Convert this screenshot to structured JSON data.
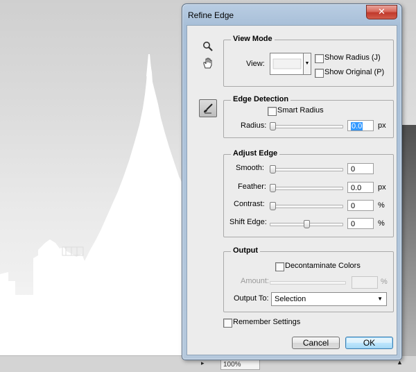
{
  "dialog": {
    "title": "Refine Edge",
    "close_glyph": "✕"
  },
  "view_mode": {
    "title": "View Mode",
    "view_label": "View:",
    "show_radius": "Show Radius (J)",
    "show_original": "Show Original (P)"
  },
  "edge_detection": {
    "title": "Edge Detection",
    "smart_radius": "Smart Radius",
    "radius_label": "Radius:",
    "radius_value": "0.0",
    "radius_unit": "px",
    "radius_slider": 0
  },
  "adjust_edge": {
    "title": "Adjust Edge",
    "smooth_label": "Smooth:",
    "smooth_value": "0",
    "feather_label": "Feather:",
    "feather_value": "0.0",
    "feather_unit": "px",
    "contrast_label": "Contrast:",
    "contrast_value": "0",
    "contrast_unit": "%",
    "shift_label": "Shift Edge:",
    "shift_value": "0",
    "shift_unit": "%",
    "shift_slider": 0.5
  },
  "output": {
    "title": "Output",
    "decontaminate": "Decontaminate Colors",
    "amount_label": "Amount:",
    "amount_value": "",
    "amount_unit": "%",
    "output_to_label": "Output To:",
    "output_to_value": "Selection"
  },
  "remember_settings": "Remember Settings",
  "buttons": {
    "cancel": "Cancel",
    "ok": "OK"
  },
  "status": {
    "zoom": "100%"
  },
  "colors": {
    "selection_highlight": "#3399ff",
    "close_button": "#c0392b",
    "ok_border": "#3c7fb1"
  }
}
